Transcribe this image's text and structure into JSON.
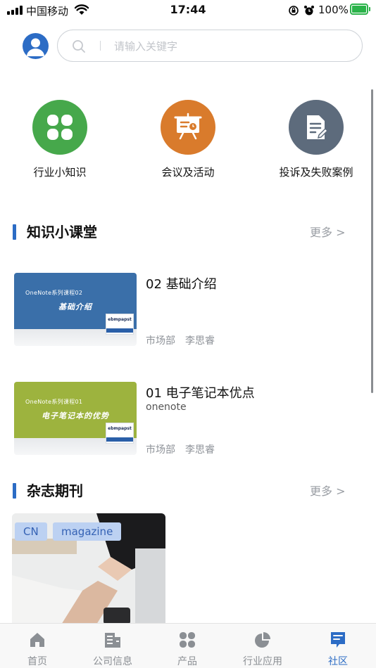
{
  "status_bar": {
    "carrier": "中国移动",
    "time": "17:44",
    "battery": "100%"
  },
  "header": {
    "search_placeholder": "请输入关键字"
  },
  "categories": [
    {
      "label": "行业小知识",
      "icon": "clover-icon",
      "color": "#46a84b"
    },
    {
      "label": "会议及活动",
      "icon": "presentation-board-icon",
      "color": "#d97b2c"
    },
    {
      "label": "投诉及失败案例",
      "icon": "document-edit-icon",
      "color": "#5d6b7c"
    }
  ],
  "knowledge": {
    "title": "知识小课堂",
    "more": "更多 >",
    "courses": [
      {
        "title": "02 基础介绍",
        "subtitle": "",
        "department": "市场部",
        "author": "李思睿",
        "thumb_series": "OneNote系列课程02",
        "thumb_title": "基础介绍",
        "thumb_color": "#3a6fa9",
        "logo_text": "ebmpapst"
      },
      {
        "title": "01 电子笔记本优点",
        "subtitle": "onenote",
        "department": "市场部",
        "author": "李思睿",
        "thumb_series": "OneNote系列课程01",
        "thumb_title": "电子笔记本的优势",
        "thumb_color": "#9db33e",
        "logo_text": "ebmpapst"
      }
    ]
  },
  "magazine": {
    "title": "杂志期刊",
    "more": "更多 >",
    "tags": [
      "CN",
      "magazine"
    ]
  },
  "tabbar": {
    "accent": "#2c6cc5",
    "items": [
      {
        "label": "首页",
        "icon": "home-icon"
      },
      {
        "label": "公司信息",
        "icon": "building-icon"
      },
      {
        "label": "产品",
        "icon": "grid-clover-icon"
      },
      {
        "label": "行业应用",
        "icon": "pie-chart-icon"
      },
      {
        "label": "社区",
        "icon": "message-icon",
        "active": true
      }
    ]
  }
}
